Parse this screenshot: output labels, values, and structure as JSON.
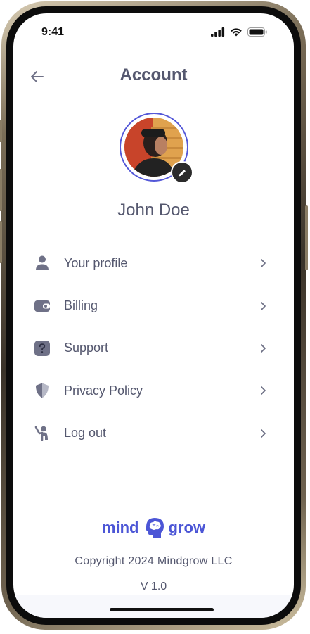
{
  "status_bar": {
    "time": "9:41"
  },
  "header": {
    "title": "Account"
  },
  "profile": {
    "name": "John Doe"
  },
  "menu": {
    "items": [
      {
        "label": "Your profile",
        "icon": "person-icon"
      },
      {
        "label": "Billing",
        "icon": "wallet-icon"
      },
      {
        "label": "Support",
        "icon": "question-icon"
      },
      {
        "label": "Privacy Policy",
        "icon": "shield-icon"
      },
      {
        "label": "Log out",
        "icon": "logout-icon"
      }
    ]
  },
  "footer": {
    "brand_left": "mind",
    "brand_right": "grow",
    "copyright": "Copyright 2024 Mindgrow LLC",
    "version": "V 1.0"
  },
  "colors": {
    "accent": "#5458d8",
    "text": "#55586f",
    "icon": "#6f7187",
    "brand": "#4c56d6"
  }
}
